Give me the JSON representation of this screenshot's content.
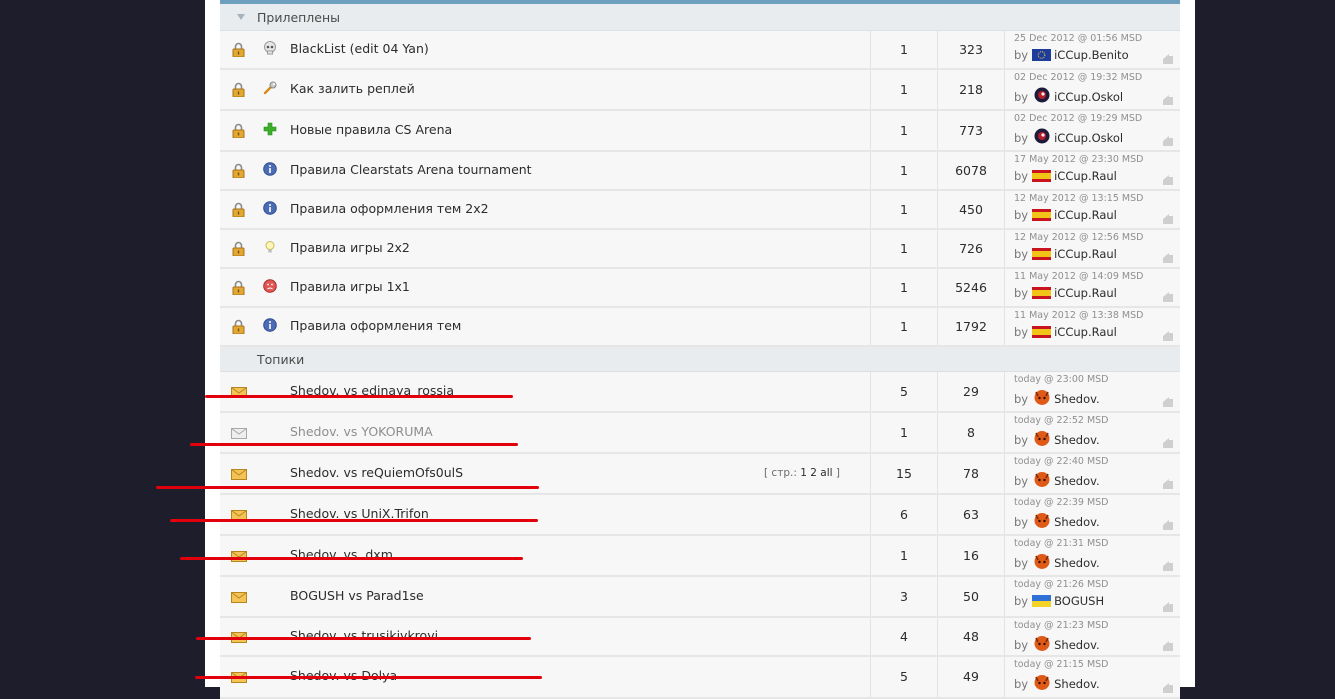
{
  "sections": {
    "pinned": "Прилеплены",
    "topics": "Топики"
  },
  "pinned_rows": [
    {
      "title": "BlackList (edit 04 Yan)",
      "icon": "skull-icon",
      "replies": "1",
      "views": "323",
      "date": "25 Dec 2012 @ 01:56 MSD",
      "user": "iCCup.Benito",
      "flag": "eu-flag"
    },
    {
      "title": "Как залить реплей",
      "icon": "wrench-icon",
      "replies": "1",
      "views": "218",
      "date": "02 Dec 2012 @ 19:32 MSD",
      "user": "iCCup.Oskol",
      "flag": "avatar-round"
    },
    {
      "title": "Новые правила CS Arena",
      "icon": "plus-icon",
      "replies": "1",
      "views": "773",
      "date": "02 Dec 2012 @ 19:29 MSD",
      "user": "iCCup.Oskol",
      "flag": "avatar-round"
    },
    {
      "title": "Правила Clearstats Arena tournament",
      "icon": "info-icon",
      "replies": "1",
      "views": "6078",
      "date": "17 May 2012 @ 23:30 MSD",
      "user": "iCCup.Raul",
      "flag": "es-flag"
    },
    {
      "title": "Правила оформления тем 2x2",
      "icon": "info-icon",
      "replies": "1",
      "views": "450",
      "date": "12 May 2012 @ 13:15 MSD",
      "user": "iCCup.Raul",
      "flag": "es-flag"
    },
    {
      "title": "Правила игры 2x2",
      "icon": "bulb-icon",
      "replies": "1",
      "views": "726",
      "date": "12 May 2012 @ 12:56 MSD",
      "user": "iCCup.Raul",
      "flag": "es-flag"
    },
    {
      "title": "Правила игры 1x1",
      "icon": "sad-face-icon",
      "replies": "1",
      "views": "5246",
      "date": "11 May 2012 @ 14:09 MSD",
      "user": "iCCup.Raul",
      "flag": "es-flag"
    },
    {
      "title": "Правила оформления тем",
      "icon": "info-icon",
      "replies": "1",
      "views": "1792",
      "date": "11 May 2012 @ 13:38 MSD",
      "user": "iCCup.Raul",
      "flag": "es-flag"
    }
  ],
  "topic_rows": [
    {
      "title": "Shedov. vs edinaya_rossia",
      "read": false,
      "replies": "5",
      "views": "29",
      "date": "today @ 23:00 MSD",
      "user": "Shedov.",
      "flag": "avatar-orange"
    },
    {
      "title": "Shedov. vs YOKORUMA",
      "read": true,
      "replies": "1",
      "views": "8",
      "date": "today @ 22:52 MSD",
      "user": "Shedov.",
      "flag": "avatar-orange"
    },
    {
      "title": "Shedov. vs reQuiemOfs0ulS",
      "read": false,
      "replies": "15",
      "views": "78",
      "date": "today @ 22:40 MSD",
      "user": "Shedov.",
      "flag": "avatar-orange",
      "pages": {
        "prefix": "[ стр.:",
        "p1": "1",
        "p2": "2",
        "all": "all",
        "suffix": "]"
      }
    },
    {
      "title": "Shedov. vs UniX.Trifon",
      "read": false,
      "replies": "6",
      "views": "63",
      "date": "today @ 22:39 MSD",
      "user": "Shedov.",
      "flag": "avatar-orange"
    },
    {
      "title": "Shedov. vs .dxm",
      "read": false,
      "replies": "1",
      "views": "16",
      "date": "today @ 21:31 MSD",
      "user": "Shedov.",
      "flag": "avatar-orange"
    },
    {
      "title": "BOGUSH vs Parad1se",
      "read": false,
      "replies": "3",
      "views": "50",
      "date": "today @ 21:26 MSD",
      "user": "BOGUSH",
      "flag": "ua-flag"
    },
    {
      "title": "Shedov. vs trusikivkrovi",
      "read": false,
      "replies": "4",
      "views": "48",
      "date": "today @ 21:23 MSD",
      "user": "Shedov.",
      "flag": "avatar-orange"
    },
    {
      "title": "Shedov. vs Dolya-",
      "read": false,
      "replies": "5",
      "views": "49",
      "date": "today @ 21:15 MSD",
      "user": "Shedov.",
      "flag": "avatar-orange"
    }
  ],
  "by_label": "by",
  "colors": {
    "background": "#1e1d2c",
    "annotation": "#e3000d",
    "header_bar": "#6f9fbf"
  }
}
